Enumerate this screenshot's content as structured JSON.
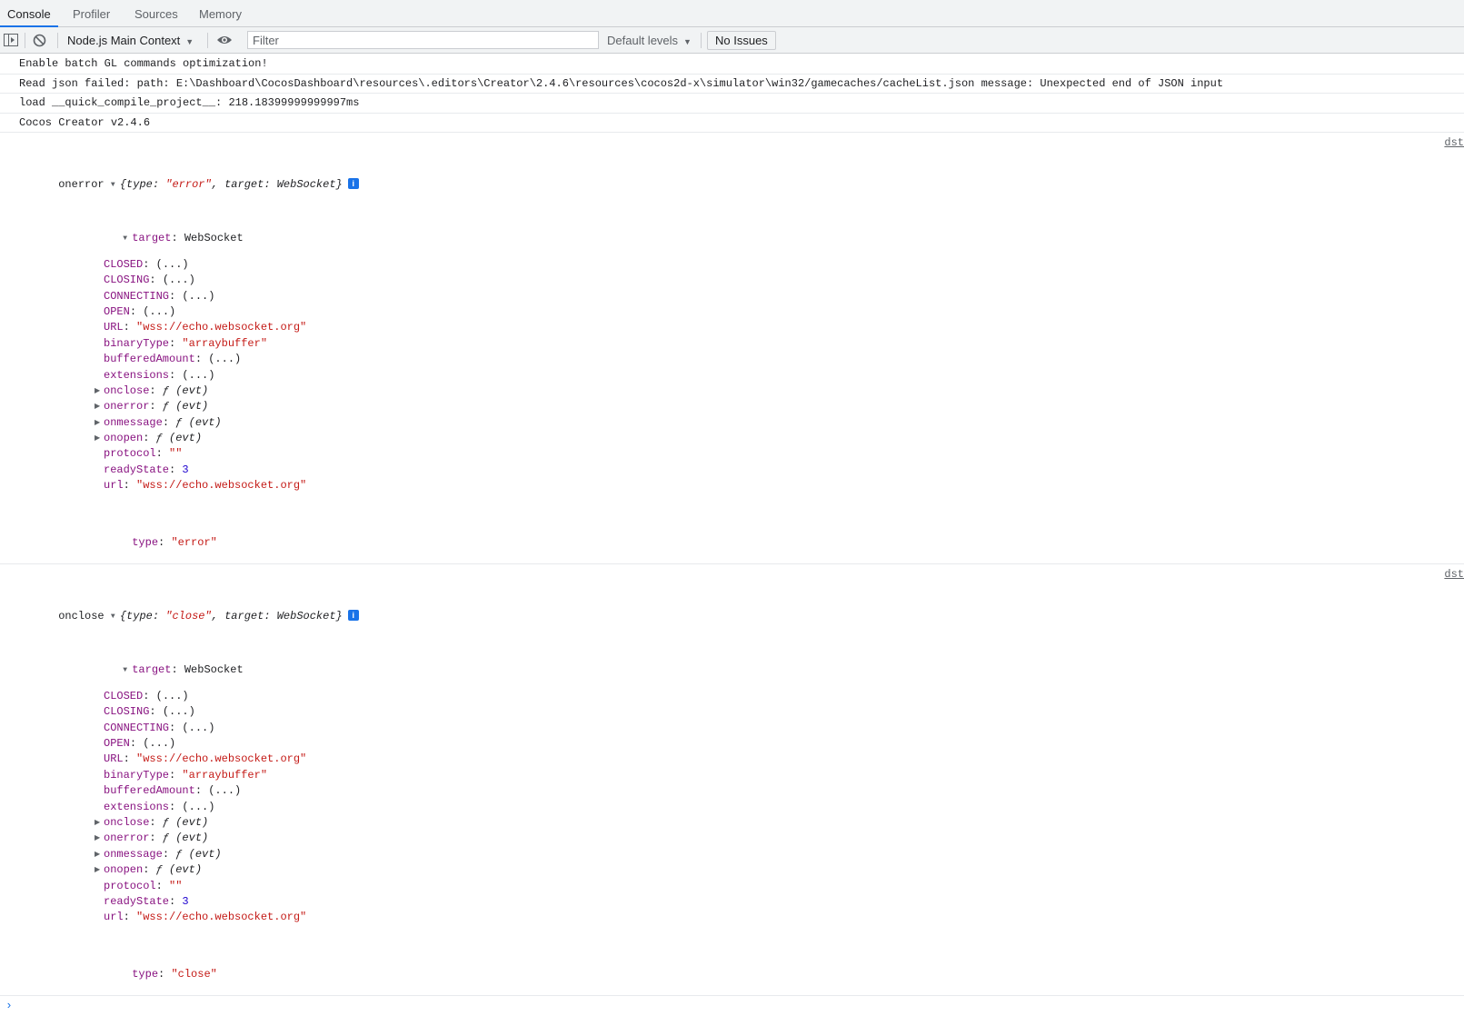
{
  "tabs": [
    "Console",
    "Profiler",
    "Sources",
    "Memory"
  ],
  "toolbar": {
    "context": "Node.js Main Context",
    "filter_placeholder": "Filter",
    "levels": "Default levels",
    "issues": "No Issues"
  },
  "messages": [
    "Enable batch GL commands optimization!",
    "Read json failed: path: E:\\Dashboard\\CocosDashboard\\resources\\.editors\\Creator\\2.4.6\\resources\\cocos2d-x\\simulator\\win32/gamecaches/cacheList.json message: Unexpected end of JSON input",
    "load __quick_compile_project__: 218.18399999999997ms",
    "Cocos Creator v2.4.6"
  ],
  "objects": [
    {
      "label": "onerror",
      "type": "error",
      "summary_type_key": "type",
      "summary_target_key": "target",
      "summary_target_value": "WebSocket",
      "source": "dst",
      "target_key": "target",
      "target_class": "WebSocket",
      "props": [
        {
          "key": "CLOSED",
          "value": "(...)",
          "kind": "plain"
        },
        {
          "key": "CLOSING",
          "value": "(...)",
          "kind": "plain"
        },
        {
          "key": "CONNECTING",
          "value": "(...)",
          "kind": "plain"
        },
        {
          "key": "OPEN",
          "value": "(...)",
          "kind": "plain"
        },
        {
          "key": "URL",
          "value": "\"wss://echo.websocket.org\"",
          "kind": "string"
        },
        {
          "key": "binaryType",
          "value": "\"arraybuffer\"",
          "kind": "string"
        },
        {
          "key": "bufferedAmount",
          "value": "(...)",
          "kind": "plain"
        },
        {
          "key": "extensions",
          "value": "(...)",
          "kind": "plain"
        },
        {
          "key": "onclose",
          "value": "ƒ (evt)",
          "kind": "func"
        },
        {
          "key": "onerror",
          "value": "ƒ (evt)",
          "kind": "func"
        },
        {
          "key": "onmessage",
          "value": "ƒ (evt)",
          "kind": "func"
        },
        {
          "key": "onopen",
          "value": "ƒ (evt)",
          "kind": "func"
        },
        {
          "key": "protocol",
          "value": "\"\"",
          "kind": "string"
        },
        {
          "key": "readyState",
          "value": "3",
          "kind": "number"
        },
        {
          "key": "url",
          "value": "\"wss://echo.websocket.org\"",
          "kind": "string"
        }
      ],
      "type_key": "type",
      "type_value": "\"error\""
    },
    {
      "label": "onclose",
      "type": "close",
      "summary_type_key": "type",
      "summary_target_key": "target",
      "summary_target_value": "WebSocket",
      "source": "dst",
      "target_key": "target",
      "target_class": "WebSocket",
      "props": [
        {
          "key": "CLOSED",
          "value": "(...)",
          "kind": "plain"
        },
        {
          "key": "CLOSING",
          "value": "(...)",
          "kind": "plain"
        },
        {
          "key": "CONNECTING",
          "value": "(...)",
          "kind": "plain"
        },
        {
          "key": "OPEN",
          "value": "(...)",
          "kind": "plain"
        },
        {
          "key": "URL",
          "value": "\"wss://echo.websocket.org\"",
          "kind": "string"
        },
        {
          "key": "binaryType",
          "value": "\"arraybuffer\"",
          "kind": "string"
        },
        {
          "key": "bufferedAmount",
          "value": "(...)",
          "kind": "plain"
        },
        {
          "key": "extensions",
          "value": "(...)",
          "kind": "plain"
        },
        {
          "key": "onclose",
          "value": "ƒ (evt)",
          "kind": "func"
        },
        {
          "key": "onerror",
          "value": "ƒ (evt)",
          "kind": "func"
        },
        {
          "key": "onmessage",
          "value": "ƒ (evt)",
          "kind": "func"
        },
        {
          "key": "onopen",
          "value": "ƒ (evt)",
          "kind": "func"
        },
        {
          "key": "protocol",
          "value": "\"\"",
          "kind": "string"
        },
        {
          "key": "readyState",
          "value": "3",
          "kind": "number"
        },
        {
          "key": "url",
          "value": "\"wss://echo.websocket.org\"",
          "kind": "string"
        }
      ],
      "type_key": "type",
      "type_value": "\"close\""
    }
  ]
}
